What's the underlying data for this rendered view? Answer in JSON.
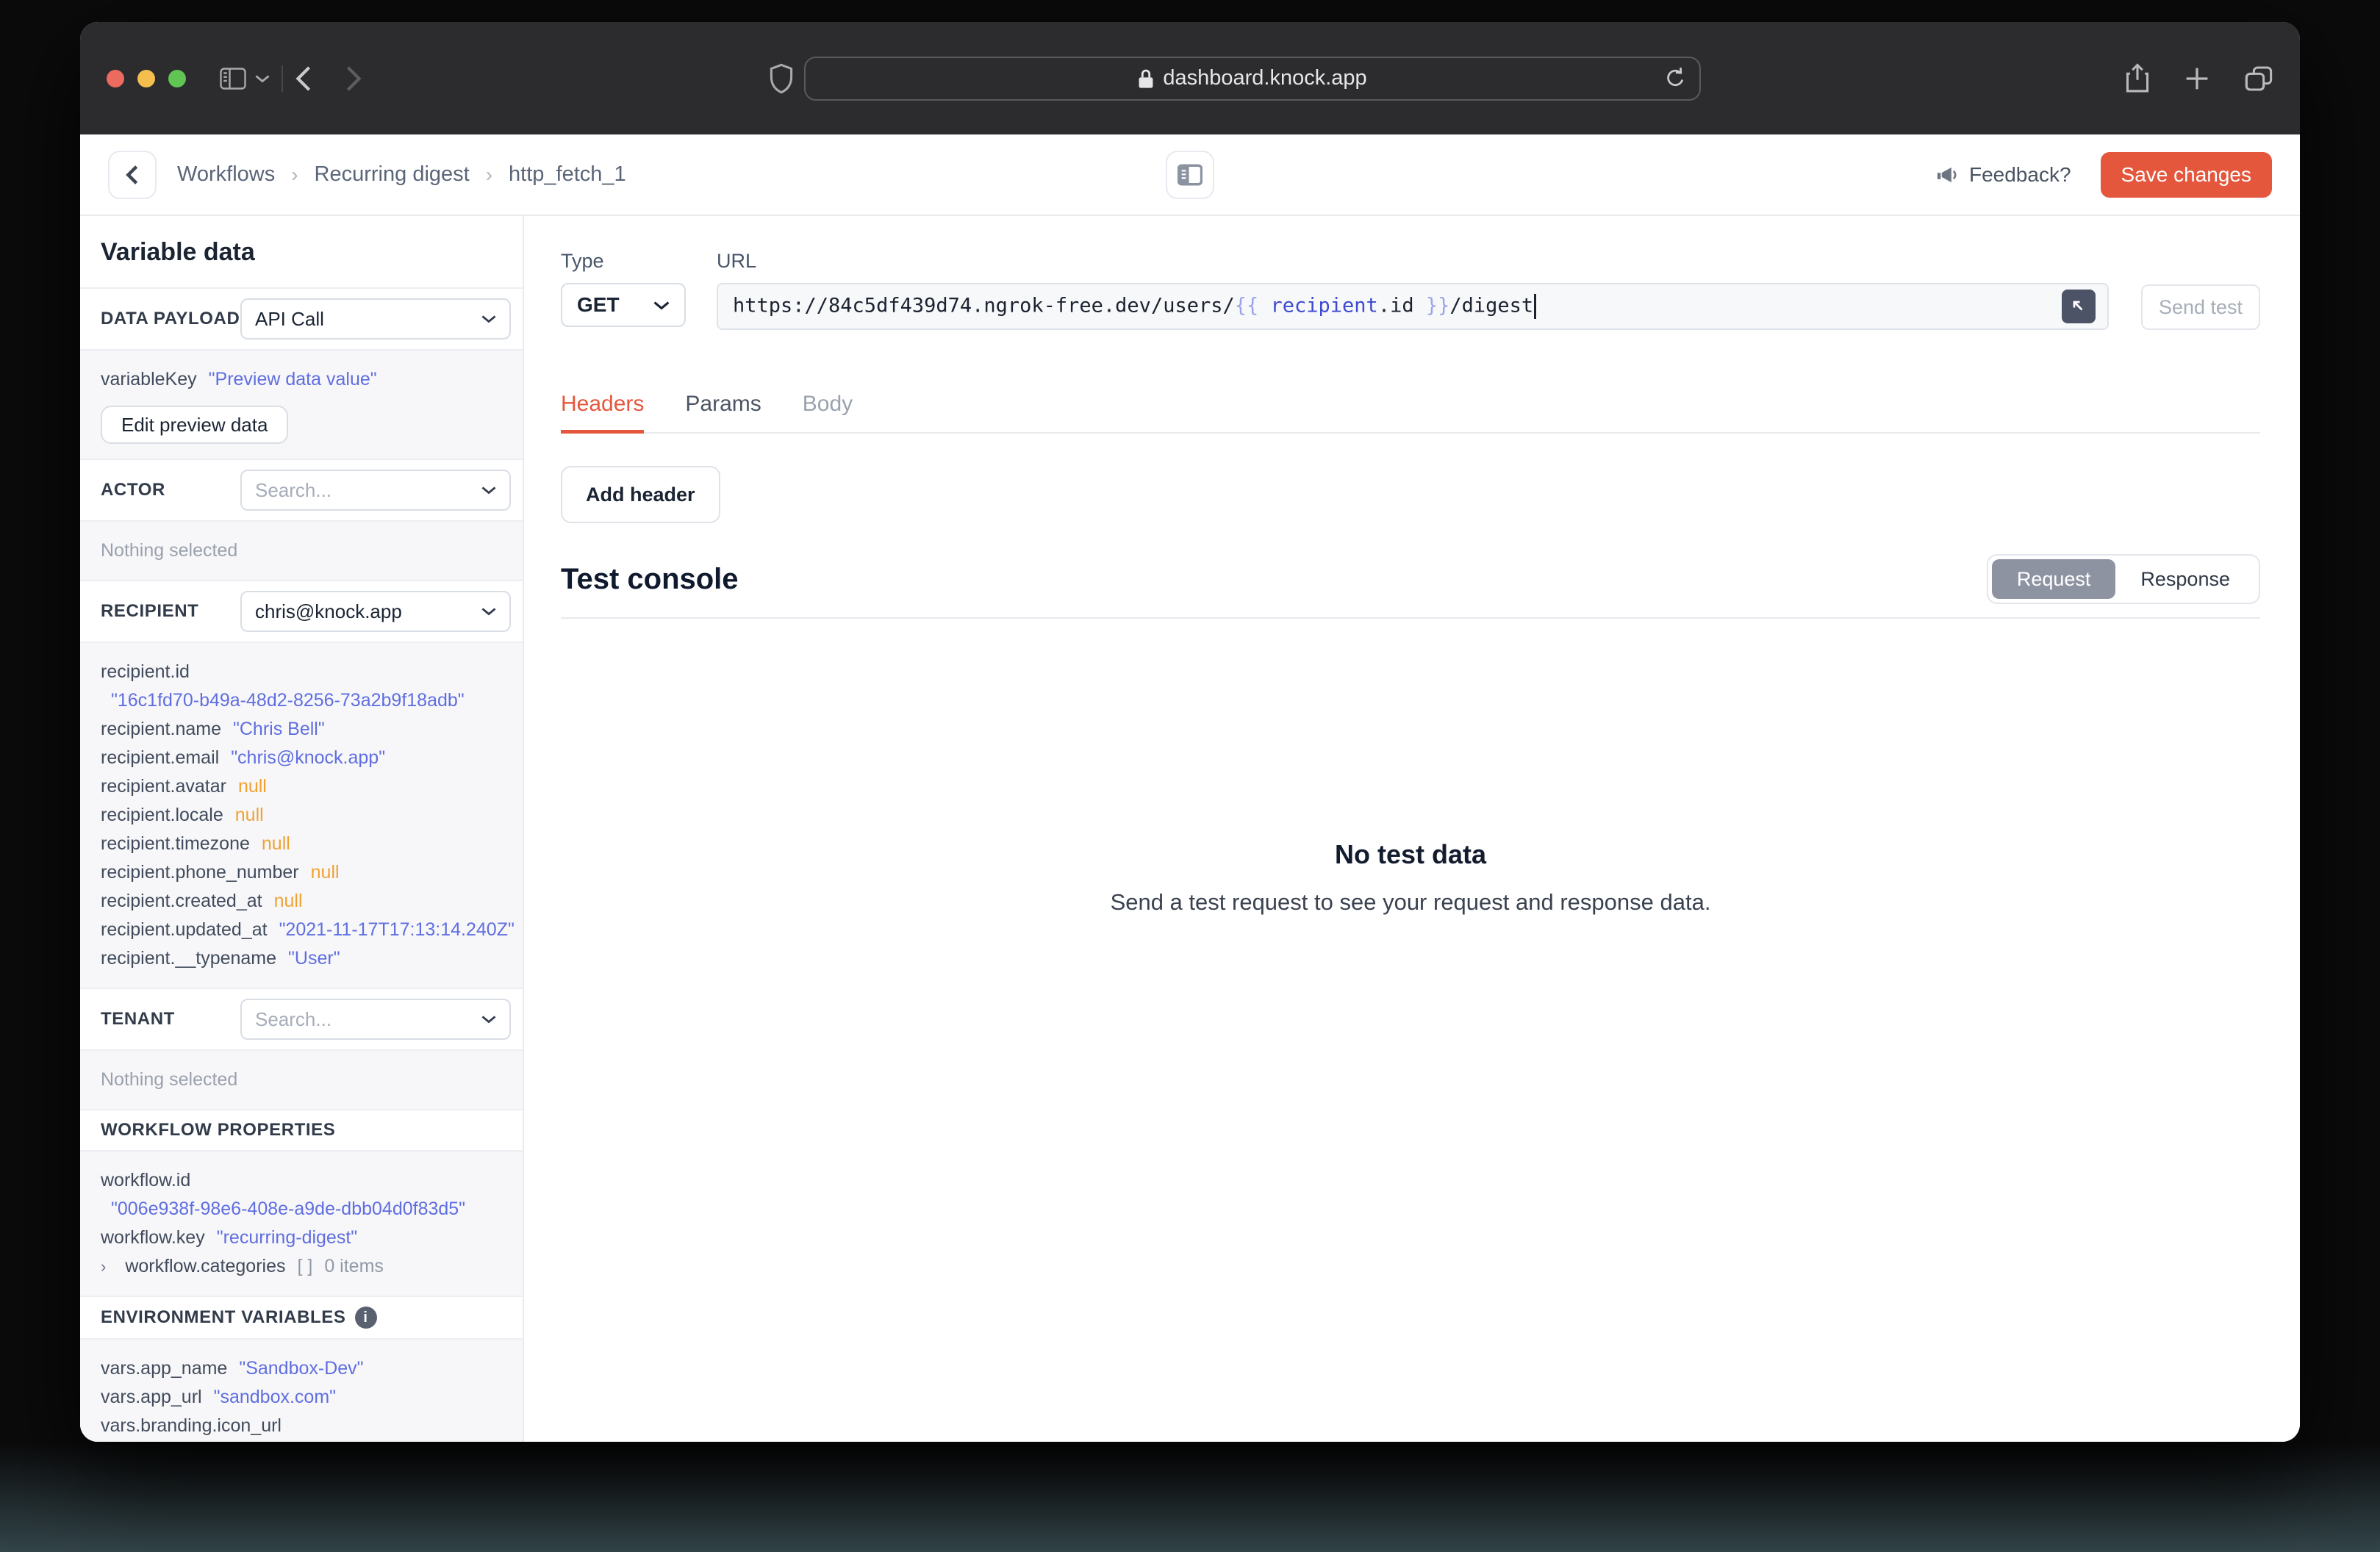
{
  "browser": {
    "url": "dashboard.knock.app"
  },
  "appbar": {
    "breadcrumb": [
      "Workflows",
      "Recurring digest",
      "http_fetch_1"
    ],
    "separator": "›",
    "feedback": "Feedback?",
    "save": "Save changes"
  },
  "sidebar": {
    "title": "Variable data",
    "data_payload": {
      "label": "DATA PAYLOAD",
      "value": "API Call"
    },
    "preview": {
      "key": "variableKey",
      "value": "\"Preview data value\"",
      "button": "Edit preview data"
    },
    "actor": {
      "label": "ACTOR",
      "placeholder": "Search...",
      "empty": "Nothing selected"
    },
    "recipient": {
      "label": "RECIPIENT",
      "value": "chris@knock.app",
      "rows": [
        {
          "key": "recipient.id",
          "value": "\"16c1fd70-b49a-48d2-8256-73a2b9f18adb\""
        },
        {
          "key": "recipient.name",
          "value": "\"Chris Bell\""
        },
        {
          "key": "recipient.email",
          "value": "\"chris@knock.app\""
        },
        {
          "key": "recipient.avatar",
          "value": "null"
        },
        {
          "key": "recipient.locale",
          "value": "null"
        },
        {
          "key": "recipient.timezone",
          "value": "null"
        },
        {
          "key": "recipient.phone_number",
          "value": "null"
        },
        {
          "key": "recipient.created_at",
          "value": "null"
        },
        {
          "key": "recipient.updated_at",
          "value": "\"2021-11-17T17:13:14.240Z\""
        },
        {
          "key": "recipient.__typename",
          "value": "\"User\""
        }
      ]
    },
    "tenant": {
      "label": "TENANT",
      "placeholder": "Search...",
      "empty": "Nothing selected"
    },
    "workflow": {
      "label": "WORKFLOW PROPERTIES",
      "id_key": "workflow.id",
      "id_value": "\"006e938f-98e6-408e-a9de-dbb04d0f83d5\"",
      "key_key": "workflow.key",
      "key_value": "\"recurring-digest\"",
      "categories_expander": "›",
      "categories_key": "workflow.categories",
      "categories_value": "[ ]",
      "categories_meta": "0 items"
    },
    "env": {
      "label": "ENVIRONMENT VARIABLES",
      "rows": [
        {
          "key": "vars.app_name",
          "value": "\"Sandbox-Dev\""
        },
        {
          "key": "vars.app_url",
          "value": "\"sandbox.com\""
        },
        {
          "key": "vars.branding.icon_url",
          "value": ""
        }
      ]
    }
  },
  "request": {
    "type_label": "Type",
    "method": "GET",
    "url_label": "URL",
    "url_parts": {
      "p1": "https://84c5df439d74.ngrok-free.dev/users/",
      "p2": "{{",
      "p3": " recipient",
      "p4": ".id ",
      "p5": "}}",
      "p6": "/digest"
    },
    "send_test": "Send test",
    "tabs": [
      "Headers",
      "Params",
      "Body"
    ],
    "add_header": "Add header"
  },
  "console": {
    "title": "Test console",
    "request_tab": "Request",
    "response_tab": "Response",
    "empty_title": "No test data",
    "empty_subtitle": "Send a test request to see your request and response data."
  }
}
